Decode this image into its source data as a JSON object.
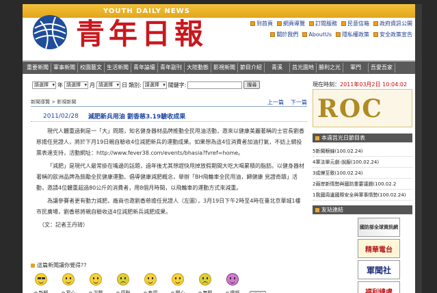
{
  "header": {
    "brand_text": "YOUTH DAILY NEWS",
    "logo_title": "青年日報",
    "links_row1": [
      "到首頁",
      "網頁導覽",
      "訂閱服務",
      "民意信箱",
      "政府資訊公開"
    ],
    "links_row2": [
      "關於我們",
      "AboutUs",
      "隱私權政策",
      "安全政策宣告"
    ]
  },
  "nav": {
    "items": [
      "重要新聞",
      "軍事新聞",
      "校園藝文",
      "生活新聞",
      "青年論壇",
      "青年副刊",
      "大陸動態",
      "影視新聞",
      "節目介紹",
      "青溪",
      "莒光園地",
      "勝利之光",
      "軍門",
      "吾愛吾家"
    ]
  },
  "filter": {
    "select_label": "請選擇",
    "year": "年",
    "month": "月",
    "day_label": "日",
    "category": "類別:",
    "keyword": "關鍵字:",
    "go": "搜尋"
  },
  "crumb": {
    "path": "新聞導覽 > 影視新聞",
    "prev": "上一篇",
    "next": "下一篇"
  },
  "article": {
    "date": "2011/02/28",
    "title": "減肥新兵用油 劉香慈3.19驗收成果",
    "p1": "現代人體重過剩是一「大」問題，知名健身器材品牌推動全民甩油活動，邀來以健康美麗著稱的士官長劉香慈擔任見證人，將於下月19日親自驗收4位減肥新兵的運動成果。如果想為這4位消費者加油打氣，不妨上網投票表達支持，活動網址：http://www.fever38.com/events/bhasia?fvref=home。",
    "p2": "「減肥」是現代人最常掛在嘴邊的話題，過年後尤其想趕快甩掉放假期間大吃大喝累積的脂肪。以健身器材著稱的歐洲品牌為鼓勵全民健康運動、倡導健康減肥概念，舉辦「BH飛輪車全民甩油，歸健康 見證奇蹟」活動，邀請4位體重超過80公斤的消費者，用8個月時間，以飛輪車的運動方式來減重。",
    "p3": "為讓參賽者更有動力減肥，廠商也邀劉香慈擔任見證人（左圖），3月19日下午2時至4時在臺北京華城1樓市民廣場，劉香慈將親自驗收這4位減肥新兵減肥成果。",
    "byline": "（文：記者王丹琦）"
  },
  "mood": {
    "question": "這篇新聞讓你覺得??",
    "options": [
      "新鮮",
      "窩心",
      "溫馨",
      "感動",
      "有用",
      "開心",
      "無聊",
      "憤怒"
    ],
    "submit": "送出"
  },
  "sidebar": {
    "now_label": "現在時刻：",
    "now_time": "2011年03月2日 10:04:02",
    "roc_text": "ROC",
    "mag_header": "本週莒光日節目表",
    "mags": [
      "5新聞眼線(100.02.24)",
      "4軍法單元劇-說服(100.02.24)",
      "3成爍至歌(100.02.24)",
      "2兩岸新情勢與國防重要議題(100.02.2",
      "1我國周邊國際安全與軍事情勢(100.02.24)"
    ],
    "links_header": "友站連結",
    "banners": [
      "國防部全球資訊網",
      "精華電台",
      "軍聞社",
      "福利總處"
    ]
  }
}
